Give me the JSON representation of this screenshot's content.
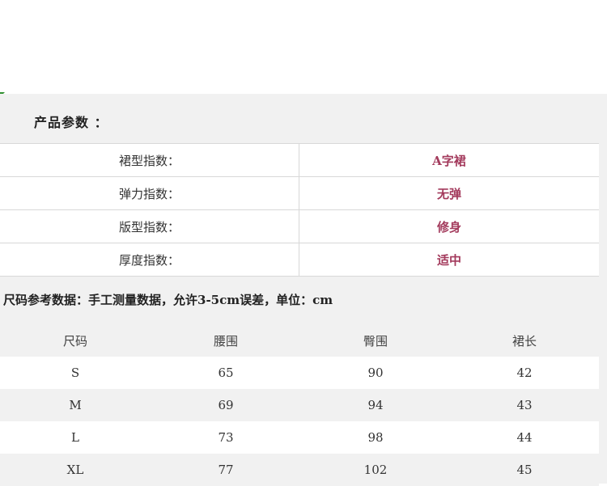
{
  "product_params": {
    "title": "产品参数 ：",
    "rows": [
      {
        "key": "裙型指数：",
        "value": "A字裙"
      },
      {
        "key": "弹力指数：",
        "value": "无弹"
      },
      {
        "key": "版型指数：",
        "value": "修身"
      },
      {
        "key": "厚度指数：",
        "value": "适中"
      }
    ]
  },
  "size_table": {
    "note": "尺码参考数据：手工测量数据，允许3-5cm误差，单位：cm",
    "headers": [
      "尺码",
      "腰围",
      "臀围",
      "裙长"
    ],
    "rows": [
      [
        "S",
        "65",
        "90",
        "42"
      ],
      [
        "M",
        "69",
        "94",
        "43"
      ],
      [
        "L",
        "73",
        "98",
        "44"
      ],
      [
        "XL",
        "77",
        "102",
        "45"
      ]
    ]
  },
  "colors": {
    "value_accent": "#a33a5c",
    "panel_background": "#f1f1f1",
    "corner_mark": "#2f8f2f"
  }
}
